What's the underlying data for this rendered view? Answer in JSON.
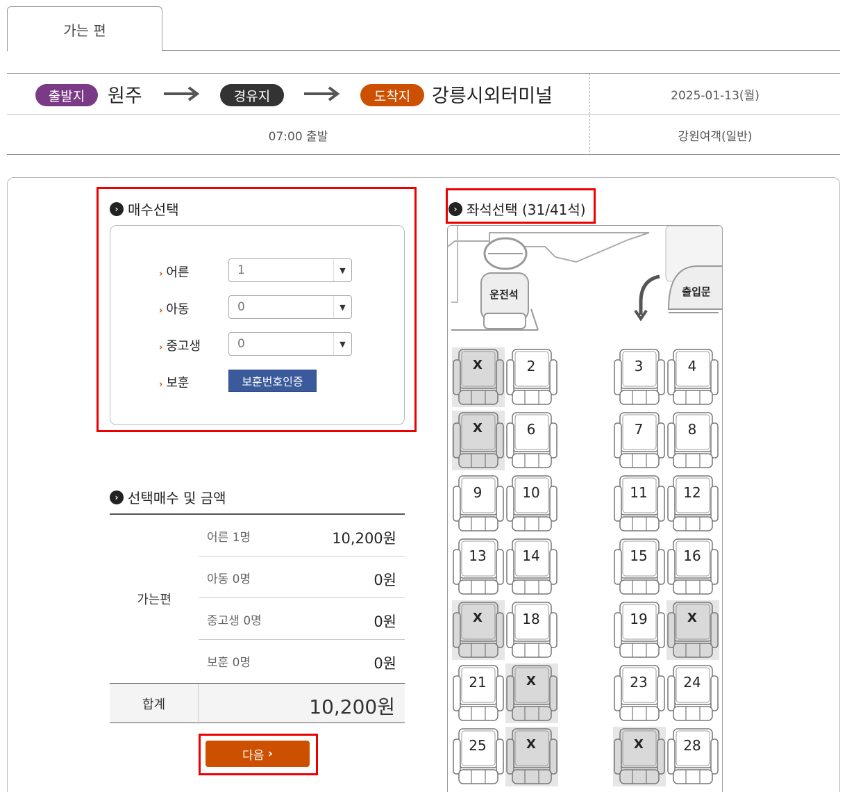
{
  "tab": {
    "label": "가는 편"
  },
  "route": {
    "departure_badge": "출발지",
    "departure_city": "원주",
    "via_badge": "경유지",
    "arrival_badge": "도착지",
    "arrival_city": "강릉시외터미널",
    "date": "2025-01-13(월)",
    "time": "07:00 출발",
    "company": "강원여객(일반)"
  },
  "count_section": {
    "title": "매수선택",
    "rows": [
      {
        "label": "어른",
        "value": "1"
      },
      {
        "label": "아동",
        "value": "0"
      },
      {
        "label": "중고생",
        "value": "0"
      }
    ],
    "veteran_label": "보훈",
    "veteran_button": "보훈번호인증"
  },
  "seat_section": {
    "title": "좌석선택 (31/41석)",
    "driver_label": "운전석",
    "door_label": "출입문",
    "seats": [
      {
        "n": "1",
        "sold": true
      },
      {
        "n": "2",
        "sold": false
      },
      {
        "n": "3",
        "sold": false
      },
      {
        "n": "4",
        "sold": false
      },
      {
        "n": "5",
        "sold": true
      },
      {
        "n": "6",
        "sold": false
      },
      {
        "n": "7",
        "sold": false
      },
      {
        "n": "8",
        "sold": false
      },
      {
        "n": "9",
        "sold": false
      },
      {
        "n": "10",
        "sold": false
      },
      {
        "n": "11",
        "sold": false
      },
      {
        "n": "12",
        "sold": false
      },
      {
        "n": "13",
        "sold": false
      },
      {
        "n": "14",
        "sold": false
      },
      {
        "n": "15",
        "sold": false
      },
      {
        "n": "16",
        "sold": false
      },
      {
        "n": "17",
        "sold": true
      },
      {
        "n": "18",
        "sold": false
      },
      {
        "n": "19",
        "sold": false
      },
      {
        "n": "20",
        "sold": true
      },
      {
        "n": "21",
        "sold": false
      },
      {
        "n": "22",
        "sold": true
      },
      {
        "n": "23",
        "sold": false
      },
      {
        "n": "24",
        "sold": false
      },
      {
        "n": "25",
        "sold": false
      },
      {
        "n": "26",
        "sold": true
      },
      {
        "n": "27",
        "sold": true
      },
      {
        "n": "28",
        "sold": false
      }
    ],
    "sold_mark": "X"
  },
  "summary": {
    "title": "선택매수 및 금액",
    "trip_label": "가는편",
    "rows": [
      {
        "label": "어른 1명",
        "value": "10,200원"
      },
      {
        "label": "아동 0명",
        "value": "0원"
      },
      {
        "label": "중고생 0명",
        "value": "0원"
      },
      {
        "label": "보훈 0명",
        "value": "0원"
      }
    ],
    "total_label": "합계",
    "total_value": "10,200원"
  },
  "next_button": "다음",
  "colors": {
    "departure": "#7a3a86",
    "via": "#333333",
    "arrival": "#cc5000",
    "button": "#cc5000",
    "cert": "#3a5a9c",
    "highlight": "#ee0000"
  }
}
